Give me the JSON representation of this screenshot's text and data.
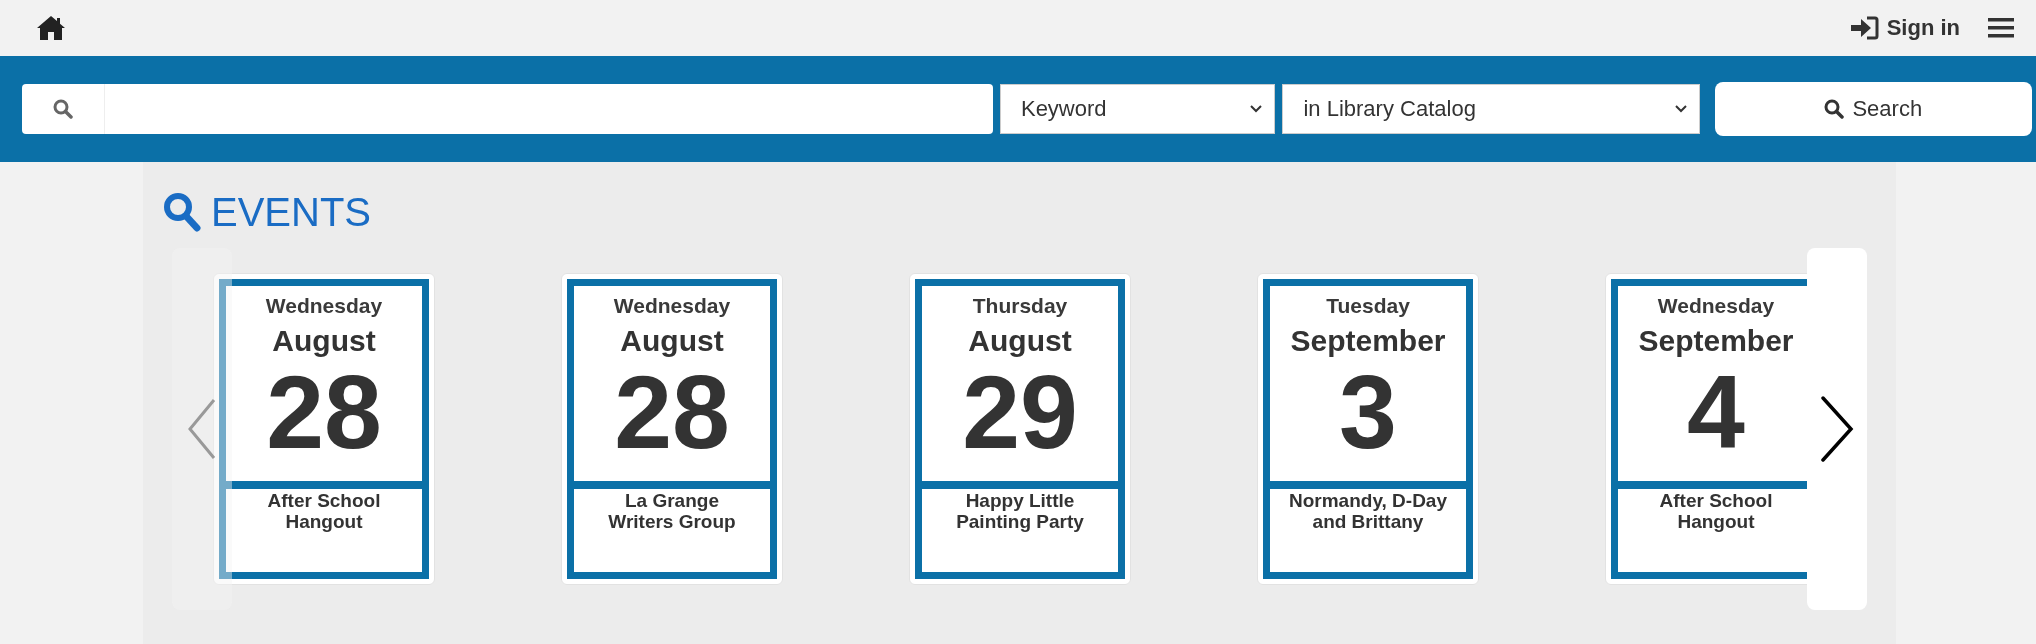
{
  "header": {
    "sign_in": "Sign in"
  },
  "search": {
    "type_select": "Keyword",
    "scope_select": "in Library Catalog",
    "button": "Search"
  },
  "section_title": "EVENTS",
  "events": [
    {
      "weekday": "Wednesday",
      "month": "August",
      "day": "28",
      "title": "After School Hangout"
    },
    {
      "weekday": "Wednesday",
      "month": "August",
      "day": "28",
      "title": "La Grange Writers Group"
    },
    {
      "weekday": "Thursday",
      "month": "August",
      "day": "29",
      "title": "Happy Little Painting Party"
    },
    {
      "weekday": "Tuesday",
      "month": "September",
      "day": "3",
      "title": "Normandy, D-Day and Brittany"
    },
    {
      "weekday": "Wednesday",
      "month": "September",
      "day": "4",
      "title": "After School Hangout"
    }
  ]
}
